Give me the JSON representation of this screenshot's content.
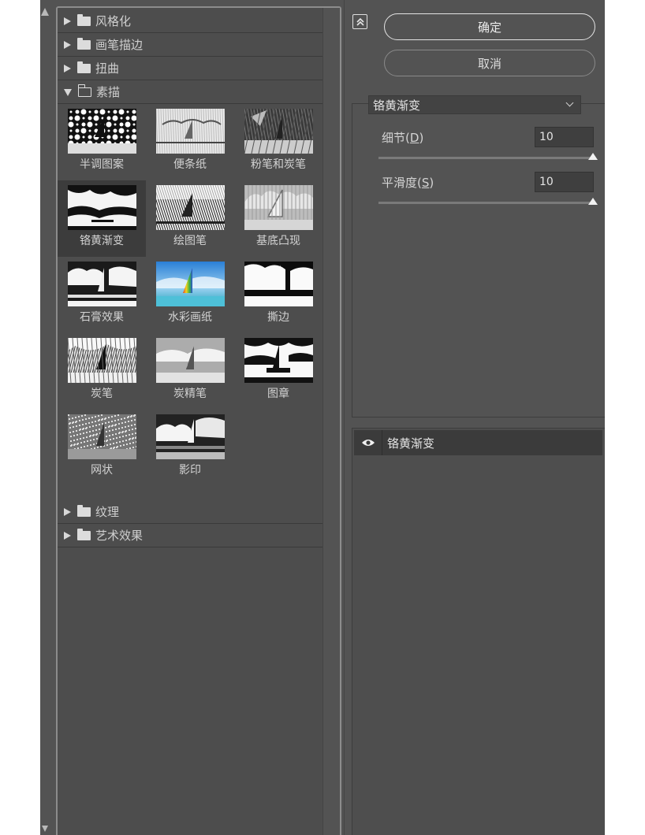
{
  "buttons": {
    "ok": "确定",
    "cancel": "取消"
  },
  "categories_top": [
    {
      "label": "风格化",
      "expanded": false
    },
    {
      "label": "画笔描边",
      "expanded": false
    },
    {
      "label": "扭曲",
      "expanded": false
    },
    {
      "label": "素描",
      "expanded": true
    }
  ],
  "sketch_filters": [
    {
      "label": "半调图案",
      "style": "halftone",
      "selected": false
    },
    {
      "label": "便条纸",
      "style": "notepaper",
      "selected": false
    },
    {
      "label": "粉笔和炭笔",
      "style": "chalk",
      "selected": false
    },
    {
      "label": "铬黄渐变",
      "style": "chrome",
      "selected": true
    },
    {
      "label": "绘图笔",
      "style": "graphicpen",
      "selected": false
    },
    {
      "label": "基底凸现",
      "style": "basrelief",
      "selected": false
    },
    {
      "label": "石膏效果",
      "style": "plaster",
      "selected": false
    },
    {
      "label": "水彩画纸",
      "style": "waterpaper",
      "selected": false
    },
    {
      "label": "撕边",
      "style": "tornedges",
      "selected": false
    },
    {
      "label": "炭笔",
      "style": "charcoal",
      "selected": false
    },
    {
      "label": "炭精笔",
      "style": "conte",
      "selected": false
    },
    {
      "label": "图章",
      "style": "stamp",
      "selected": false
    },
    {
      "label": "网状",
      "style": "reticulation",
      "selected": false
    },
    {
      "label": "影印",
      "style": "photocopy",
      "selected": false
    }
  ],
  "categories_bottom": [
    {
      "label": "纹理",
      "expanded": false
    },
    {
      "label": "艺术效果",
      "expanded": false
    }
  ],
  "settings": {
    "filter_select": "铬黄渐变",
    "detail": {
      "label": "细节",
      "key": "D",
      "value": "10",
      "level": 1.0
    },
    "smoothness": {
      "label": "平滑度",
      "key": "S",
      "value": "10",
      "level": 1.0
    }
  },
  "layer": {
    "name": "铬黄渐变"
  },
  "colors": {
    "panel": "#535353",
    "gallery": "#4d4d4d",
    "selected_cell": "#3c3c3c"
  }
}
